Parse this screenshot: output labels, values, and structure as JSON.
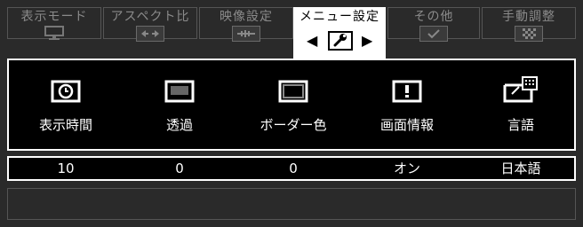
{
  "tabs": [
    {
      "label": "表示モード"
    },
    {
      "label": "アスペクト比"
    },
    {
      "label": "映像設定"
    },
    {
      "label": "メニュー設定"
    },
    {
      "label": "その他"
    },
    {
      "label": "手動調整"
    }
  ],
  "nav": {
    "left_arrow": "◀",
    "right_arrow": "▶"
  },
  "menu_items": [
    {
      "label": "表示時間",
      "value": "10",
      "icon": "clock-icon"
    },
    {
      "label": "透過",
      "value": "0",
      "icon": "transparency-icon"
    },
    {
      "label": "ボーダー色",
      "value": "0",
      "icon": "border-color-icon"
    },
    {
      "label": "画面情報",
      "value": "オン",
      "icon": "info-icon"
    },
    {
      "label": "言語",
      "value": "日本語",
      "icon": "language-icon"
    }
  ],
  "status_text": ""
}
